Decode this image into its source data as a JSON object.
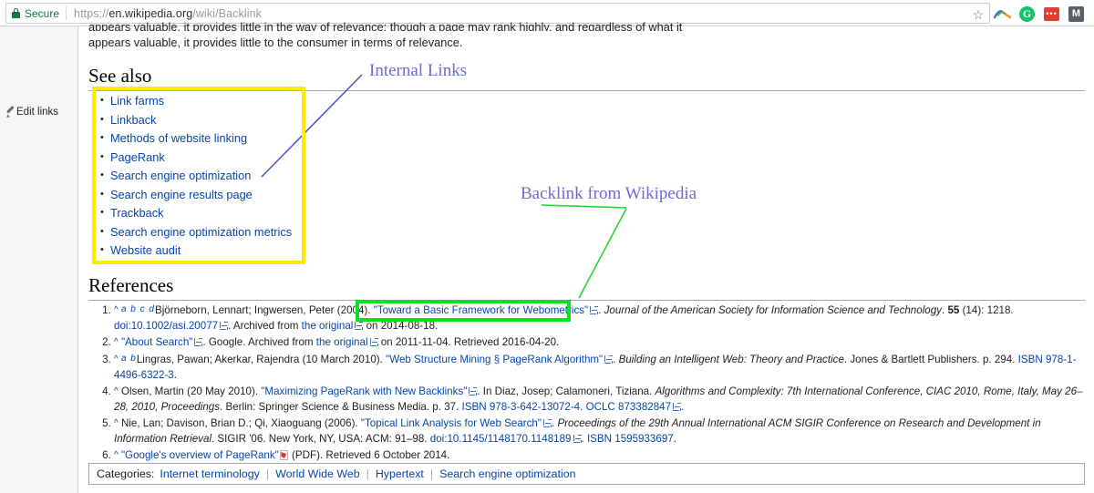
{
  "browser": {
    "security_label": "Secure",
    "url_scheme": "https://",
    "url_domain": "en.wikipedia.org",
    "url_path": "/wiki/Backlink",
    "star_glyph": "☆",
    "extensions": [
      {
        "name": "arc-extension-icon",
        "label": ""
      },
      {
        "name": "grammarly-extension-icon",
        "label": "G"
      },
      {
        "name": "red-extension-icon",
        "label": "•••"
      },
      {
        "name": "m-extension-icon",
        "label": "M"
      }
    ]
  },
  "sidebar": {
    "edit_links_label": "Edit links"
  },
  "article": {
    "clipped_paragraph_top": "appears valuable, it provides little in the way of relevance; though a page may rank highly, and regardless of what it",
    "paragraph_line": "appears valuable, it provides little to the consumer in terms of relevance.",
    "see_also_heading": "See also",
    "see_also_links": [
      "Link farms",
      "Linkback",
      "Methods of website linking",
      "PageRank",
      "Search engine optimization",
      "Search engine results page",
      "Trackback",
      "Search engine optimization metrics",
      "Website audit"
    ],
    "references_heading": "References",
    "references": [
      {
        "backref": "^",
        "letters": "a b c d",
        "pre": "Björneborn, Lennart; Ingwersen, Peter (2004). ",
        "link": "\"Toward a Basic Framework for Webometrics\"",
        "italic": "Journal of the American Society for Information Science and Technology",
        "volume": "55",
        "post": " (14): 1218. ",
        "doi": "doi:10.1002/asi.20077",
        "tail": ". Archived from ",
        "tail_link": "the original",
        "tail_end": " on 2014-08-18."
      },
      {
        "backref": "^",
        "link": "\"About Search\"",
        "text": ". Google. Archived from ",
        "tail_link": "the original",
        "tail_end": " on 2011-11-04. Retrieved 2016-04-20."
      },
      {
        "backref": "^",
        "letters": "a b",
        "pre": "Lingras, Pawan; Akerkar, Rajendra (10 March 2010). ",
        "link": "\"Web Structure Mining § PageRank Algorithm\"",
        "italic": "Building an Intelligent Web: Theory and Practice",
        "post": ". Jones & Bartlett Publishers. p. 294. ",
        "isbn_label": "ISBN",
        "isbn_value": "978-1-4496-6322-3",
        "tail_end": "."
      },
      {
        "backref": "^",
        "pre": "Olsen, Martin (20 May 2010). ",
        "link": "\"Maximizing PageRank with New Backlinks\"",
        "mid": ". In Diaz, Josep; Calamoneri, Tiziana. ",
        "italic": "Algorithms and Complexity: 7th International Conference, CIAC 2010, Rome, Italy, May 26–28, 2010, Proceedings",
        "post": ". Berlin: Springer Science & Business Media. p. 37. ",
        "isbn_label": "ISBN",
        "isbn_value": "978-3-642-13072-4",
        "oclc_label": "OCLC",
        "oclc_value": "873382847",
        "tail_end": "."
      },
      {
        "backref": "^",
        "pre": "Nie, Lan; Davison, Brian D.; Qi, Xiaoguang (2006). ",
        "link": "\"Topical Link Analysis for Web Search\"",
        "italic": "Proceedings of the 29th Annual International ACM SIGIR Conference on Research and Development in Information Retrieval",
        "post": ". SIGIR '06. New York, NY, USA: ACM: 91–98. ",
        "doi": "doi:10.1145/1148170.1148189",
        "isbn_label": "ISBN",
        "isbn_value": "1595933697",
        "tail_end": "."
      },
      {
        "backref": "^",
        "link": "\"Google's overview of PageRank\"",
        "text": " (PDF). Retrieved 6 October 2014."
      }
    ]
  },
  "annotations": [
    {
      "id": "internal-links",
      "text": "Internal Links",
      "color": "#6b6bdb"
    },
    {
      "id": "backlink-from-wikipedia",
      "text": "Backlink from Wikipedia",
      "color": "#6b6bdb"
    }
  ],
  "highlights": {
    "see_also_box_color": "#ffea00",
    "reference_box_color": "#0ae21f"
  },
  "categories": {
    "label": "Categories:",
    "items": [
      "Internet terminology",
      "World Wide Web",
      "Hypertext",
      "Search engine optimization"
    ],
    "separator": "|"
  }
}
